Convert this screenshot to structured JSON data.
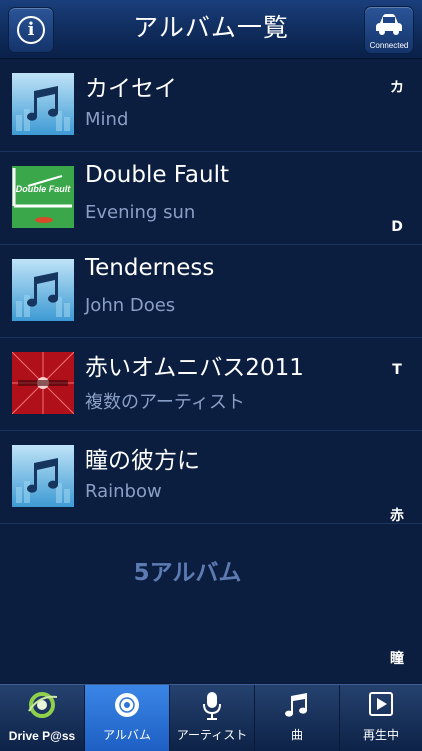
{
  "header": {
    "title": "アルバム一覧",
    "connected_label": "Connected"
  },
  "albums": [
    {
      "title": "カイセイ",
      "artist": "Mind",
      "art": "music-note-placeholder"
    },
    {
      "title": "Double Fault",
      "artist": "Evening sun",
      "art": "double-fault-cover",
      "art_text": "Double Fault"
    },
    {
      "title": "Tenderness",
      "artist": "John Does",
      "art": "music-note-placeholder"
    },
    {
      "title": "赤いオムニバス2011",
      "artist": "複数のアーティスト",
      "art": "red-omnibus-cover"
    },
    {
      "title": "瞳の彼方に",
      "artist": "Rainbow",
      "art": "music-note-placeholder"
    }
  ],
  "album_count": "5アルバム",
  "index": [
    "カ",
    "D",
    "T",
    "赤",
    "瞳"
  ],
  "tabs": [
    {
      "label": "Drive P@ss",
      "icon": "drive-pass-logo"
    },
    {
      "label": "アルバム",
      "icon": "album-disc-icon",
      "active": true
    },
    {
      "label": "アーティスト",
      "icon": "microphone-icon"
    },
    {
      "label": "曲",
      "icon": "music-note-icon"
    },
    {
      "label": "再生中",
      "icon": "play-icon"
    }
  ],
  "colors": {
    "background": "#0b1e3f",
    "header": "#0f2c5c",
    "active_tab": "#2e75d8",
    "subtitle": "#8a9fc6"
  }
}
